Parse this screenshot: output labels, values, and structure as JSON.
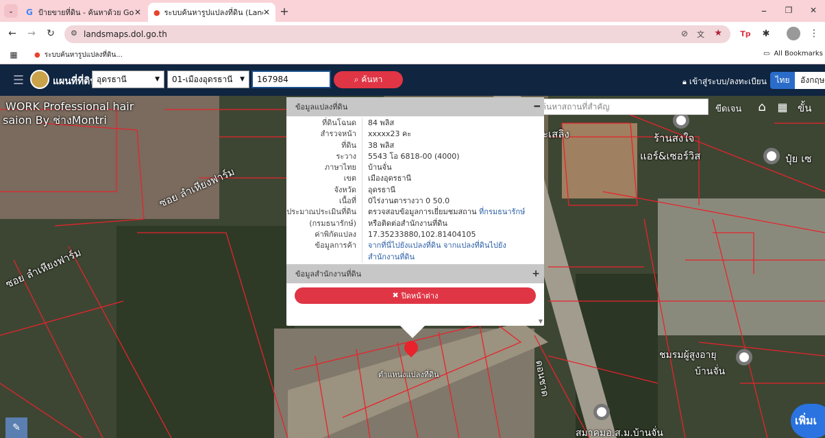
{
  "browser": {
    "tabs": [
      {
        "title": "ป้ายขายที่ดิน - ค้นหาด้วย Google",
        "active": false
      },
      {
        "title": "ระบบค้นหารูปแปลงที่ดิน (LandsMa",
        "active": true
      }
    ],
    "url": "landsmaps.dol.go.th",
    "bookmark_label": "ระบบค้นหารูปแปลงที่ดิน...",
    "all_bookmarks": "All Bookmarks",
    "window_icons": {
      "minimize": "–",
      "restore": "❐",
      "close": "✕"
    }
  },
  "app": {
    "title": "แผนที่ที่ดิน",
    "province": "อุดรธานี",
    "district": "01-เมืองอุดรธานี",
    "parcel_no": "167984",
    "search_label": "ค้นหา",
    "login_label": "เข้าสู่ระบบ/ลงทะเบียน",
    "lang_th": "ไทย",
    "lang_en": "อังกฤษ"
  },
  "map_tools": {
    "place_search_placeholder": "ค้นหาสถานที่สำคัญ",
    "measure_label": "ขีดเจน",
    "advanced_label": "ขั้น",
    "more_label": "เพิ่มเ"
  },
  "map_labels": {
    "work_line1": "WORK Professional hair",
    "work_line2": "saion By ช่างMontri",
    "soi1": "ซอย ลำเหียงฟาร์ม",
    "soi2": "ซอย ลำเหียงฟาร์ม",
    "saleri": "ะเสลิง",
    "shop": "ร้านสงใจ",
    "air": "แอร์&เซอร์วิส",
    "pui": "ปุ๋ย เซ",
    "club1": "ชมรมผู้สูงอายุ",
    "club2": "บ้านจั่น",
    "assoc": "สมาคมอ.ส.ม.บ้านจั่น",
    "road": "ดอนชาด",
    "marker": "ตำแหน่งแปลงที่ดิน"
  },
  "popup": {
    "section1": "ข้อมูลแปลงที่ดิน",
    "section2": "ข้อมูลสำนักงานที่ดิน",
    "close_label": "ปิดหน้าต่าง",
    "rows": [
      {
        "k": "ที่ดินโฉนด",
        "v": "84 พลิส"
      },
      {
        "k": "สำรวจหน้า",
        "v": "xxxxx23 คะ"
      },
      {
        "k": "ที่ดิน",
        "v": "38 พลิส"
      },
      {
        "k": "ระวาง",
        "v": "5543 โอ 6818-00 (4000)"
      },
      {
        "k": "ภาษาไทย",
        "v": "บ้านจั่น"
      },
      {
        "k": "เขต",
        "v": "เมืองอุดรธานี"
      },
      {
        "k": "จังหวัด",
        "v": "อุดรธานี"
      },
      {
        "k": "เนื้อที่",
        "v": "0ไร่งานตารางวา 0 50.0"
      }
    ],
    "appraisal_k1": "ประมาณประเมินที่ดิน",
    "appraisal_k2": "(กรมธนารักษ์)",
    "appraisal_v1": "ตรวจสอบข้อมูลการเยี่ยมชมสถาน",
    "appraisal_link": "ที่กรมธนารักษ์",
    "appraisal_v2": "หรือติดต่อสำนักงานที่ดิน",
    "coord_k": "ค่าพิกัดแปลง",
    "coord_v": "17.35233880,102.81404105",
    "trade_k": "ข้อมูลการค้า",
    "trade_v1": "จากที่นี่ไปยังแปลงที่ดิน",
    "trade_v2": "จากแปลงที่ดินไปยัง",
    "trade_v3": "สำนักงานที่ดิน"
  },
  "colors": {
    "appbar": "#0f2540",
    "search_btn": "#e03545",
    "tab_strip": "#f9d3d8",
    "parcel_line": "#e8232c"
  }
}
